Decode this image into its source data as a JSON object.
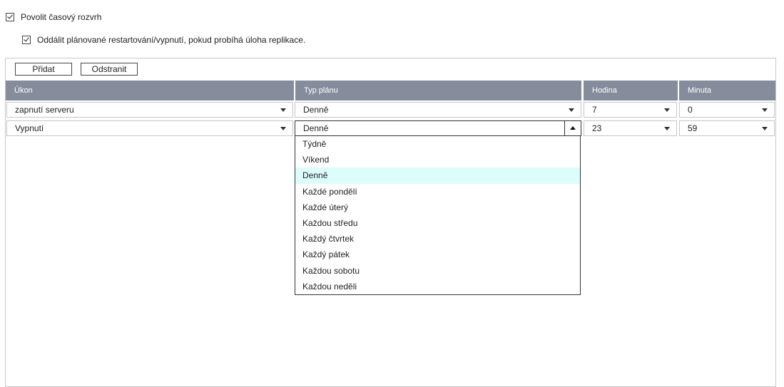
{
  "options": {
    "enable_schedule": "Povolit časový rozvrh",
    "delay_replication": "Oddálit plánované restartování/vypnutí, pokud probíhá úloha replikace."
  },
  "toolbar": {
    "add_label": "Přidat",
    "remove_label": "Odstranit"
  },
  "table": {
    "headers": [
      "Úkon",
      "Typ plánu",
      "Hodina",
      "Minuta"
    ],
    "rows": [
      {
        "action": "zapnutí serveru",
        "plan": "Denně",
        "hour": "7",
        "minute": "0"
      },
      {
        "action": "Vypnutí",
        "plan": "Denně",
        "hour": "23",
        "minute": "59"
      }
    ]
  },
  "dropdown": {
    "selected": "Denně",
    "items": [
      "Týdně",
      "Víkend",
      "Denně",
      "Každé pondělí",
      "Každé úterý",
      "Každou středu",
      "Každý čtvrtek",
      "Každý pátek",
      "Každou sobotu",
      "Každou neděli"
    ]
  },
  "colors": {
    "header_bg": "#858d9c",
    "highlight": "#dcfdfb"
  }
}
